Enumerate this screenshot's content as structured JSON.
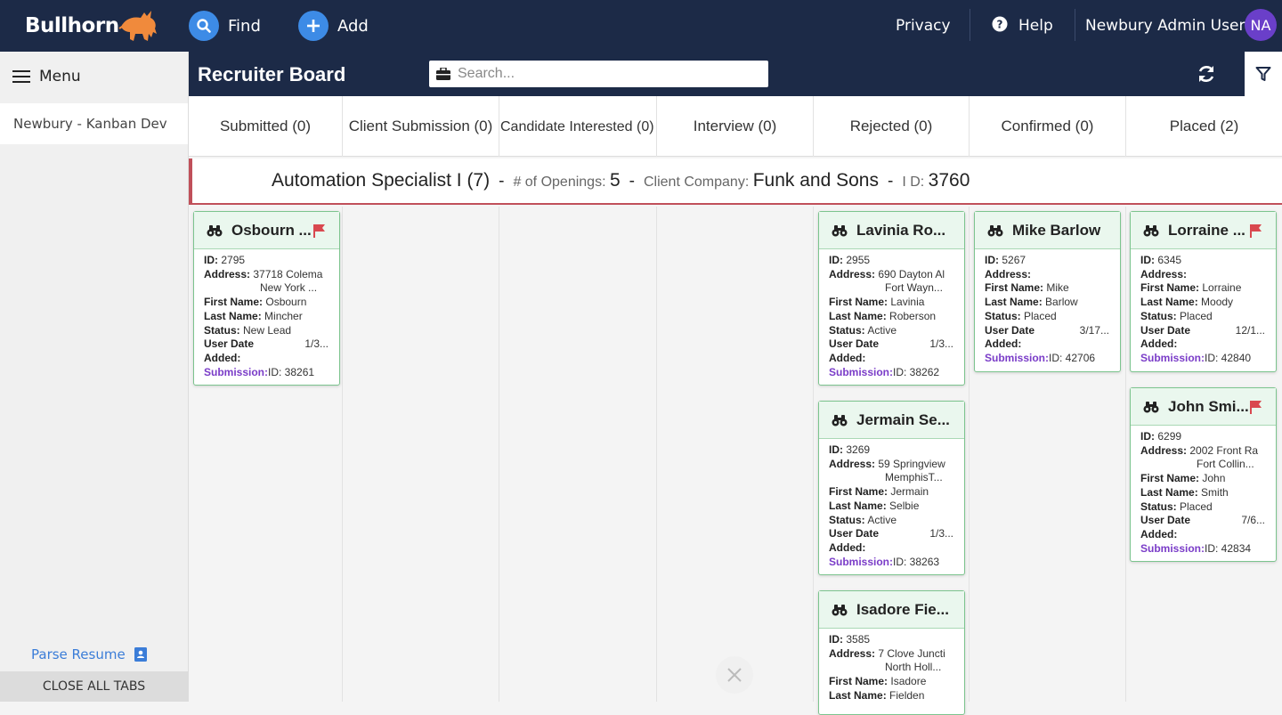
{
  "topnav": {
    "logo": "Bullhorn",
    "find_label": "Find",
    "add_label": "Add",
    "privacy_label": "Privacy",
    "help_label": "Help",
    "user_name": "Newbury Admin User",
    "avatar_initials": "NA"
  },
  "sidebar": {
    "menu_label": "Menu",
    "open_tab": "Newbury - Kanban Dev",
    "parse_resume": "Parse Resume",
    "close_all_tabs": "CLOSE ALL TABS"
  },
  "board": {
    "title": "Recruiter Board",
    "search_placeholder": "Search..."
  },
  "columns": [
    "Submitted (0)",
    "Client Submission (0)",
    "Candidate Interested (0)",
    "Interview (0)",
    "Rejected (0)",
    "Confirmed (0)",
    "Placed (2)"
  ],
  "job": {
    "title": "Automation Specialist I (7)",
    "openings_label": "# of Openings:",
    "openings": "5",
    "company_label": "Client Company:",
    "company": "Funk and Sons",
    "id_label": "I D:",
    "id": "3760"
  },
  "labels": {
    "id": "ID:",
    "address": "Address:",
    "first_name": "First Name:",
    "last_name": "Last Name:",
    "status": "Status:",
    "user_date": "User Date",
    "added": "Added:",
    "submission": "Submission:"
  },
  "cards": [
    {
      "name": "Osbourn ...",
      "id": "2795",
      "address1": "37718 Colema",
      "address2": "New York ...",
      "first": "Osbourn",
      "last": "Mincher",
      "status": "New Lead",
      "date": "1/3...",
      "submission": "ID: 38261"
    },
    {
      "name": "Lavinia Ro...",
      "id": "2955",
      "address1": "690 Dayton Al",
      "address2": "Fort Wayn...",
      "first": "Lavinia",
      "last": "Roberson",
      "status": "Active",
      "date": "1/3...",
      "submission": "ID: 38262"
    },
    {
      "name": "Jermain Se...",
      "id": "3269",
      "address1": "59 Springview",
      "address2": "MemphisT...",
      "first": "Jermain",
      "last": "Selbie",
      "status": "Active",
      "date": "1/3...",
      "submission": "ID: 38263"
    },
    {
      "name": "Isadore Fie...",
      "id": "3585",
      "address1": "7 Clove Juncti",
      "address2": "North Holl...",
      "first": "Isadore",
      "last": "Fielden"
    },
    {
      "name": "Mike Barlow",
      "id": "5267",
      "first": "Mike",
      "last": "Barlow",
      "status": "Placed",
      "date": "3/17...",
      "submission": "ID: 42706"
    },
    {
      "name": "Lorraine ...",
      "id": "6345",
      "first": "Lorraine",
      "last": "Moody",
      "status": "Placed",
      "date": "12/1...",
      "submission": "ID: 42840"
    },
    {
      "name": "John Smi...",
      "id": "6299",
      "address1": "2002 Front Ra",
      "address2": "Fort Collin...",
      "first": "John",
      "last": "Smith",
      "status": "Placed",
      "date": "7/6...",
      "submission": "ID: 42834"
    }
  ]
}
